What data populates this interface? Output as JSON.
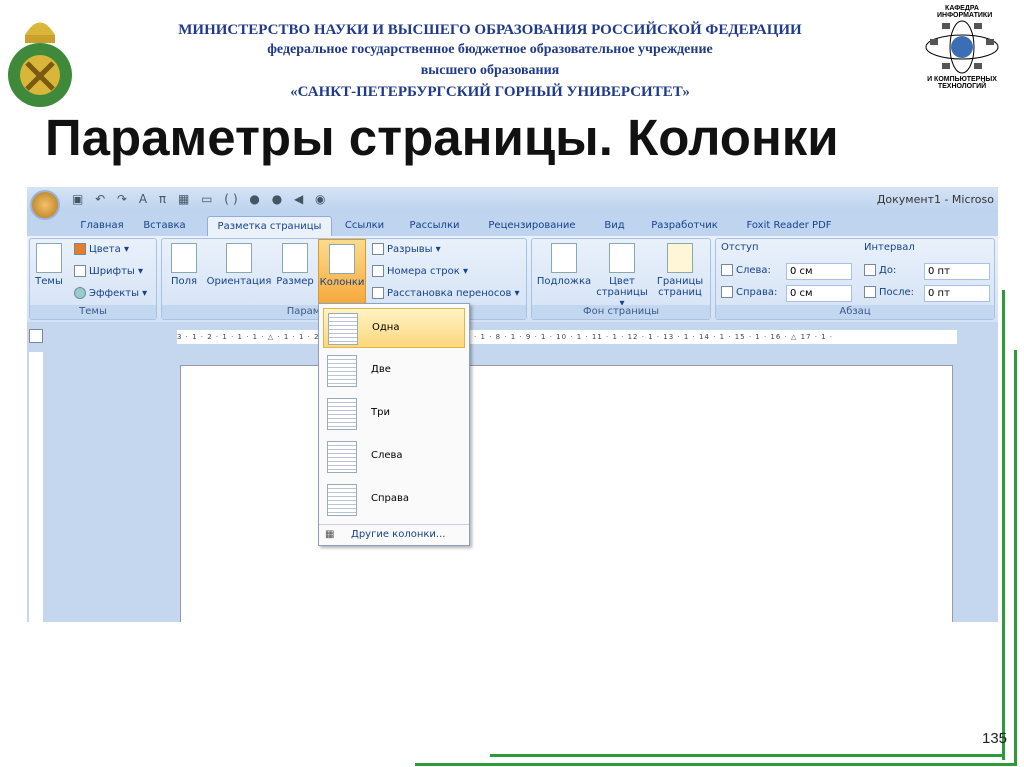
{
  "header": {
    "line1": "МИНИСТЕРСТВО НАУКИ И ВЫСШЕГО ОБРАЗОВАНИЯ РОССИЙСКОЙ ФЕДЕРАЦИИ",
    "line2": "федеральное государственное бюджетное образовательное учреждение",
    "line3": "высшего образования",
    "line4": "«САНКТ-ПЕТЕРБУРГСКИЙ ГОРНЫЙ УНИВЕРСИТЕТ»"
  },
  "logo_right": {
    "top": "КАФЕДРА ИНФОРМАТИКИ",
    "bottom": "И КОМПЬЮТЕРНЫХ ТЕХНОЛОГИЙ"
  },
  "slide_title": "Параметры страницы. Колонки",
  "word": {
    "window_title": "Документ1 - Microso",
    "tabs": [
      "Главная",
      "Вставка",
      "Разметка страницы",
      "Ссылки",
      "Рассылки",
      "Рецензирование",
      "Вид",
      "Разработчик",
      "Foxit Reader PDF"
    ],
    "groups": {
      "themes": {
        "label": "Темы",
        "big": "Темы",
        "items": [
          "Цвета ▾",
          "Шрифты ▾",
          "Эффекты ▾"
        ]
      },
      "page_setup": {
        "label": "Параметры страницы",
        "buttons": [
          "Поля",
          "Ориентация",
          "Размер",
          "Колонки"
        ],
        "items": [
          "Разрывы ▾",
          "Номера строк ▾",
          "Расстановка переносов ▾"
        ]
      },
      "background": {
        "label": "Фон страницы",
        "buttons": [
          "Подложка",
          "Цвет страницы ▾",
          "Границы страниц"
        ]
      },
      "paragraph": {
        "label": "Абзац",
        "indent": "Отступ",
        "left_label": "Слева:",
        "left_value": "0 см",
        "right_label": "Справа:",
        "right_value": "0 см",
        "spacing": "Интервал",
        "before_label": "До:",
        "before_value": "0 пт",
        "after_label": "После:",
        "after_value": "0 пт"
      }
    },
    "ruler": "3 · 1 · 2 · 1 · 1 · 1 · △ · 1 · 1 · 2 · 1 · 3 · 1 · 4 · 1 · 5 · 1 · 6 · 1 · 7 · 1 · 8 · 1 · 9 · 1 · 10 · 1 · 11 · 1 · 12 · 1 · 13 · 1 · 14 · 1 · 15 · 1 · 16 · △ 17 · 1 ·",
    "columns_menu": [
      "Одна",
      "Две",
      "Три",
      "Слева",
      "Справа"
    ],
    "more_columns": "Другие колонки..."
  },
  "page_number": "135"
}
